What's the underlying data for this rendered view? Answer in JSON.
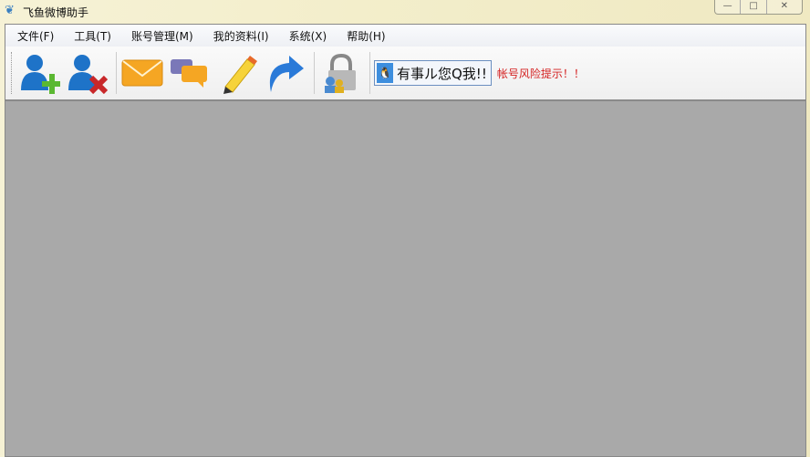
{
  "window": {
    "title": "飞鱼微博助手",
    "minimize": "—",
    "maximize": "□",
    "close": "✕"
  },
  "menu": [
    "文件(F)",
    "工具(T)",
    "账号管理(M)",
    "我的资料(I)",
    "系统(X)",
    "帮助(H)"
  ],
  "toolbar": {
    "qq_button": "有事ル您Q我!!",
    "risk_link": "帐号风险提示！！"
  }
}
